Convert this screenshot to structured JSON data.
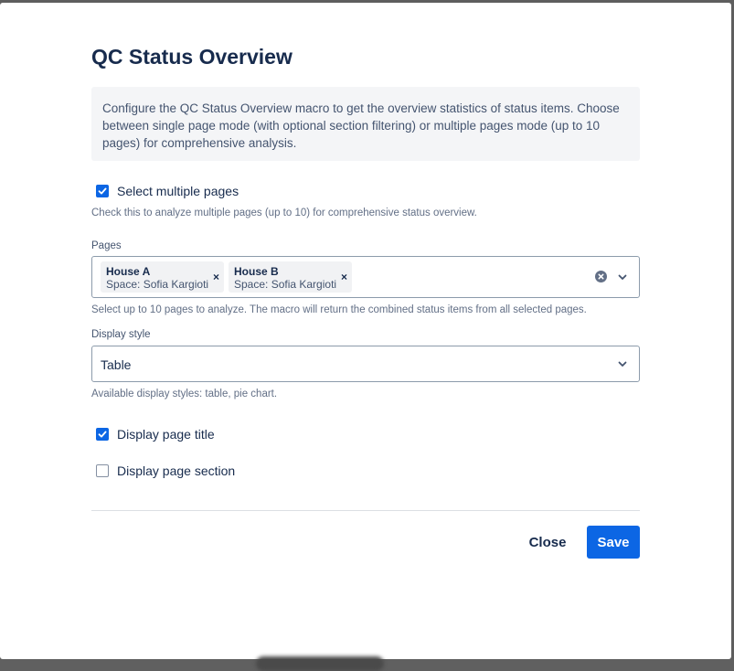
{
  "dialog": {
    "title": "QC Status Overview",
    "info": "Configure the QC Status Overview macro to get the overview statistics of status items. Choose between single page mode (with optional section filtering) or multiple pages mode (up to 10 pages) for comprehensive analysis."
  },
  "multiple_pages": {
    "label": "Select multiple pages",
    "checked": true,
    "help": "Check this to analyze multiple pages (up to 10) for comprehensive status overview."
  },
  "pages": {
    "label": "Pages",
    "selected": [
      {
        "title": "House A",
        "space": "Space: Sofia Kargioti",
        "remove": "×"
      },
      {
        "title": "House B",
        "space": "Space: Sofia Kargioti",
        "remove": "×"
      }
    ],
    "help": "Select up to 10 pages to analyze. The macro will return the combined status items from all selected pages."
  },
  "display_style": {
    "label": "Display style",
    "value": "Table",
    "help": "Available display styles: table, pie chart."
  },
  "display_page_title": {
    "label": "Display page title",
    "checked": true
  },
  "display_page_section": {
    "label": "Display page section",
    "checked": false
  },
  "footer": {
    "close_label": "Close",
    "save_label": "Save"
  },
  "colors": {
    "primary": "#0c66e4",
    "text": "#172b4d",
    "info_bg": "#f4f5f7"
  }
}
